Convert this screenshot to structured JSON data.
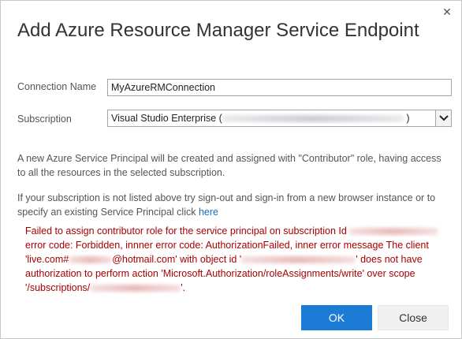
{
  "dialog": {
    "title": "Add Azure Resource Manager Service Endpoint",
    "close_glyph": "✕"
  },
  "form": {
    "connection_name_label": "Connection Name",
    "connection_name_value": "MyAzureRMConnection",
    "subscription_label": "Subscription",
    "subscription_prefix": "Visual Studio Enterprise (",
    "subscription_suffix": ")"
  },
  "info": {
    "paragraph1": "A new Azure Service Principal will be created and assigned with \"Contributor\" role, having access to all the resources in the selected subscription.",
    "paragraph2_text": "If your subscription is not listed above try sign-out and sign-in from a new browser instance or to specify an existing Service Principal click ",
    "paragraph2_link": "here"
  },
  "error": {
    "part1": "Failed to assign contributor role for the service principal on subscription Id",
    "part2": "error code: Forbidden, innner error code: AuthorizationFailed, inner error message The client 'live.com#",
    "part3": "@hotmail.com' with object id '",
    "part4": "' does not have authorization to perform action 'Microsoft.Authorization/roleAssignments/write' over scope '/subscriptions/",
    "part5": "'."
  },
  "footer": {
    "ok_label": "OK",
    "close_label": "Close"
  },
  "colors": {
    "primary": "#1c7cd5",
    "error": "#a80000",
    "link": "#106ebe"
  }
}
